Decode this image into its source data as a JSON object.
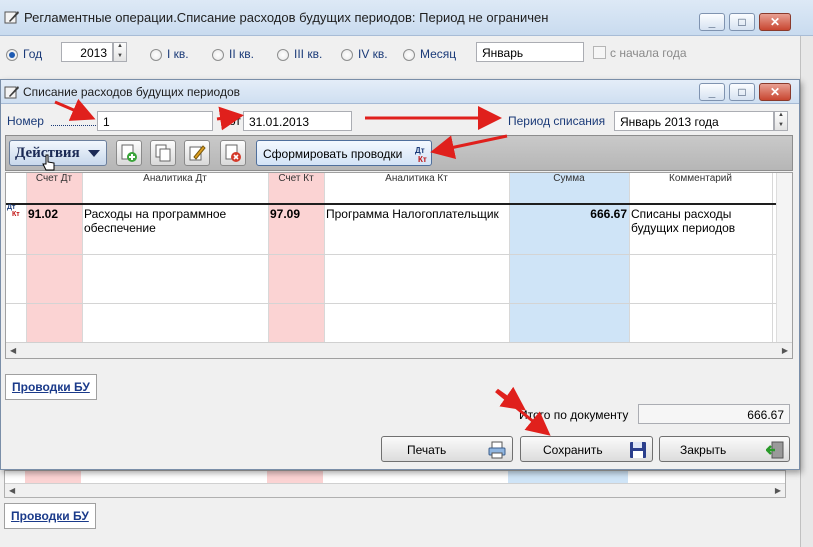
{
  "main_window": {
    "title": "Регламентные операции.Списание расходов будущих периодов: Период не ограничен",
    "period": {
      "year_label": "Год",
      "year_value": "2013",
      "q1_label": "I кв.",
      "q2_label": "II кв.",
      "q3_label": "III кв.",
      "q4_label": "IV кв.",
      "month_label": "Месяц",
      "month_value": "Январь",
      "from_start_label": "с начала года"
    },
    "bottom_tab_label": "Проводки БУ"
  },
  "dialog": {
    "title": "Списание расходов будущих периодов",
    "number_label": "Номер",
    "number_value": "1",
    "date_label": "от",
    "date_value": "31.01.2013",
    "period_label": "Период списания",
    "period_value": "Январь 2013 года",
    "actions_label": "Действия",
    "generate_label": "Сформировать проводки",
    "table": {
      "headers": [
        "Счет Дт",
        "Аналитика Дт",
        "Счет Кт",
        "Аналитика Кт",
        "Сумма",
        "Комментарий"
      ],
      "rows": [
        {
          "debit_account": "91.02",
          "debit_analytics_line1": "Расходы на программное",
          "debit_analytics_line2": "обеспечение",
          "credit_account": "97.09",
          "credit_analytics": "Программа Налогоплательщик",
          "amount": "666.67",
          "comment_line1": "Списаны расходы",
          "comment_line2": "будущих периодов"
        }
      ],
      "row_icon_dt": "Дт",
      "row_icon_kt": "Кт"
    },
    "tab_label": "Проводки БУ",
    "total_label": "Итого по документу",
    "total_value": "666.67",
    "print_label": "Печать",
    "save_label": "Сохранить",
    "close_label": "Закрыть"
  },
  "colors": {
    "debit_col_bg": "#fbd3d3",
    "credit_col_bg": "#fbd3d3",
    "amount_col_bg": "#cfe4f7",
    "arrow": "#e0201c",
    "label_blue": "#1a3a78"
  }
}
